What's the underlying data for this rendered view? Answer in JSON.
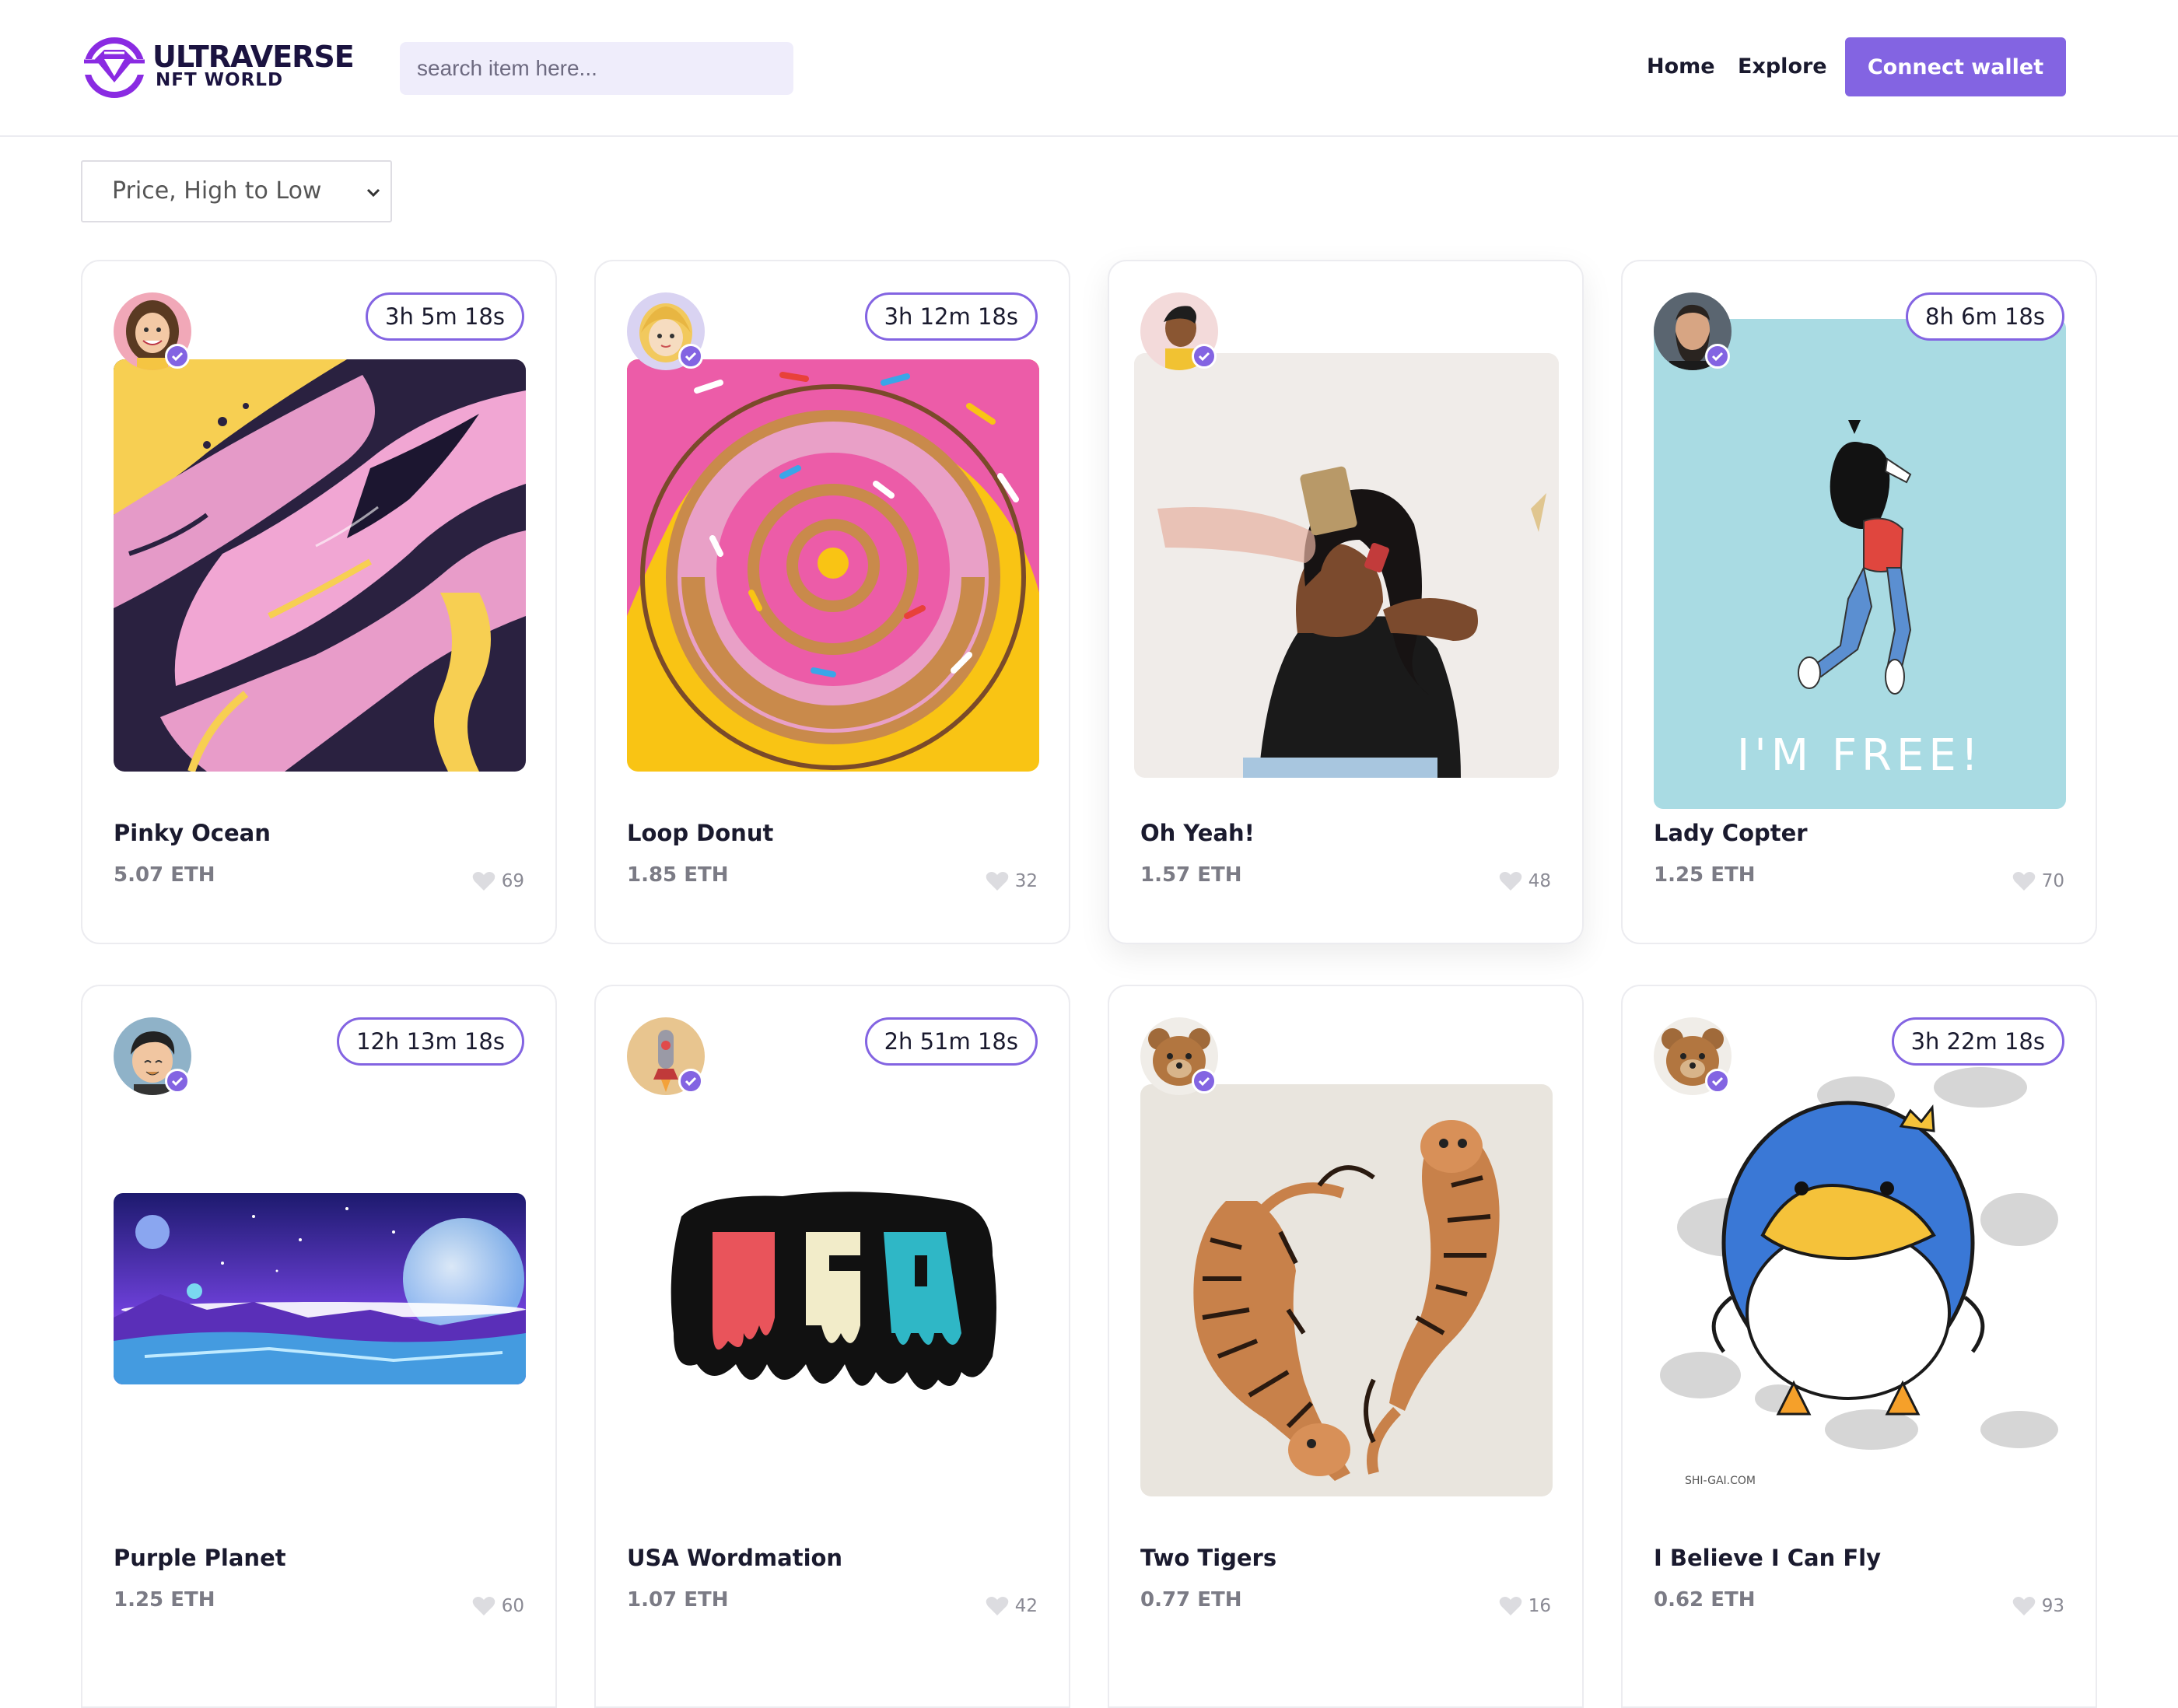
{
  "brand": {
    "title": "ULTRAVERSE",
    "subtitle": "NFT WORLD",
    "accent": "#8364e2"
  },
  "search": {
    "placeholder": "search item here..."
  },
  "nav": {
    "home": "Home",
    "explore": "Explore",
    "connect": "Connect wallet"
  },
  "sort": {
    "selected": "Price, High to Low",
    "icon": "chevron-down-icon"
  },
  "items": [
    {
      "title": "Pinky Ocean",
      "price": "5.07 ETH",
      "likes": "69",
      "countdown": "3h 5m 18s"
    },
    {
      "title": "Loop Donut",
      "price": "1.85 ETH",
      "likes": "32",
      "countdown": "3h 12m 18s"
    },
    {
      "title": "Oh Yeah!",
      "price": "1.57 ETH",
      "likes": "48",
      "countdown": ""
    },
    {
      "title": "Lady Copter",
      "price": "1.25 ETH",
      "likes": "70",
      "countdown": "8h 6m 18s",
      "art_text": "I'M FREE!"
    },
    {
      "title": "Purple Planet",
      "price": "1.25 ETH",
      "likes": "60",
      "countdown": "12h 13m 18s"
    },
    {
      "title": "USA Wordmation",
      "price": "1.07 ETH",
      "likes": "42",
      "countdown": "2h 51m 18s",
      "art_text": "USA"
    },
    {
      "title": "Two Tigers",
      "price": "0.77 ETH",
      "likes": "16",
      "countdown": ""
    },
    {
      "title": "I Believe I Can Fly",
      "price": "0.62 ETH",
      "likes": "93",
      "countdown": "3h 22m 18s",
      "art_text": "SHI-GAI.COM"
    }
  ]
}
